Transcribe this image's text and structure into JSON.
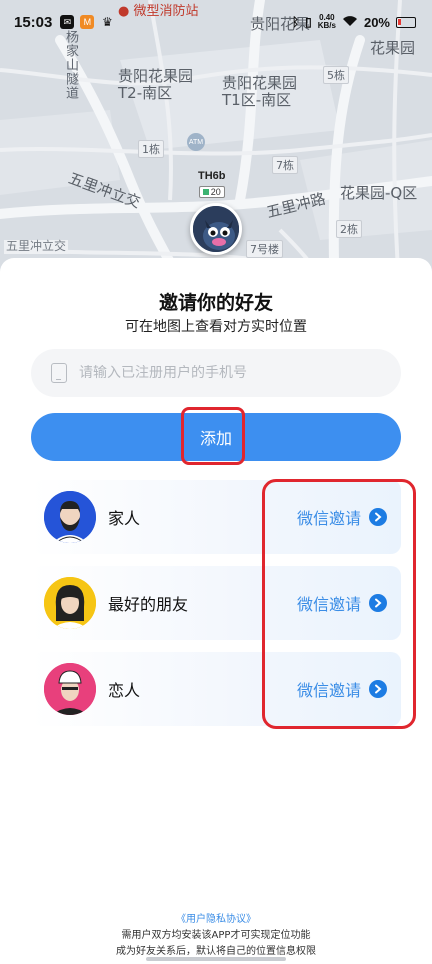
{
  "status_bar": {
    "time": "15:03",
    "network_speed_value": "0.40",
    "network_speed_unit": "KB/s",
    "battery": "20%",
    "icons": [
      "mail-icon",
      "app-badge-icon",
      "crown-icon",
      "bluetooth-icon",
      "vibrate-icon",
      "wifi-icon",
      "battery-icon"
    ]
  },
  "map": {
    "poi_top": "微型消防站",
    "labels": {
      "road_vertical": "杨家山隧道",
      "area1": "贵阳花果园\nT2-南区",
      "area2": "贵阳花果园\nT1区-南区",
      "area3": "贵阳花果",
      "area4": "花果园",
      "area5": "花果园-Q区",
      "road1": "五里冲立交",
      "road2": "五里冲路",
      "road3": "五里冲立交",
      "b5": "5栋",
      "b1": "1栋",
      "b7": "7栋",
      "b2": "2栋",
      "b7l": "7号楼"
    },
    "device": {
      "name": "TH6b",
      "battery": "20"
    }
  },
  "sheet": {
    "title": "邀请你的好友",
    "subtitle": "可在地图上查看对方实时位置",
    "phone_placeholder": "请输入已注册用户的手机号",
    "add_label": "添加",
    "contacts": [
      {
        "name": "家人",
        "invite": "微信邀请"
      },
      {
        "name": "最好的朋友",
        "invite": "微信邀请"
      },
      {
        "name": "恋人",
        "invite": "微信邀请"
      }
    ],
    "privacy_link": "《用户隐私协议》",
    "footnote_line1": "需用户双方均安装该APP才可实现定位功能",
    "footnote_line2": "成为好友关系后，默认将自己的位置信息权限"
  },
  "colors": {
    "accent": "#3d8ff0",
    "highlight": "#e0262e",
    "invite_text": "#3b8de6"
  }
}
